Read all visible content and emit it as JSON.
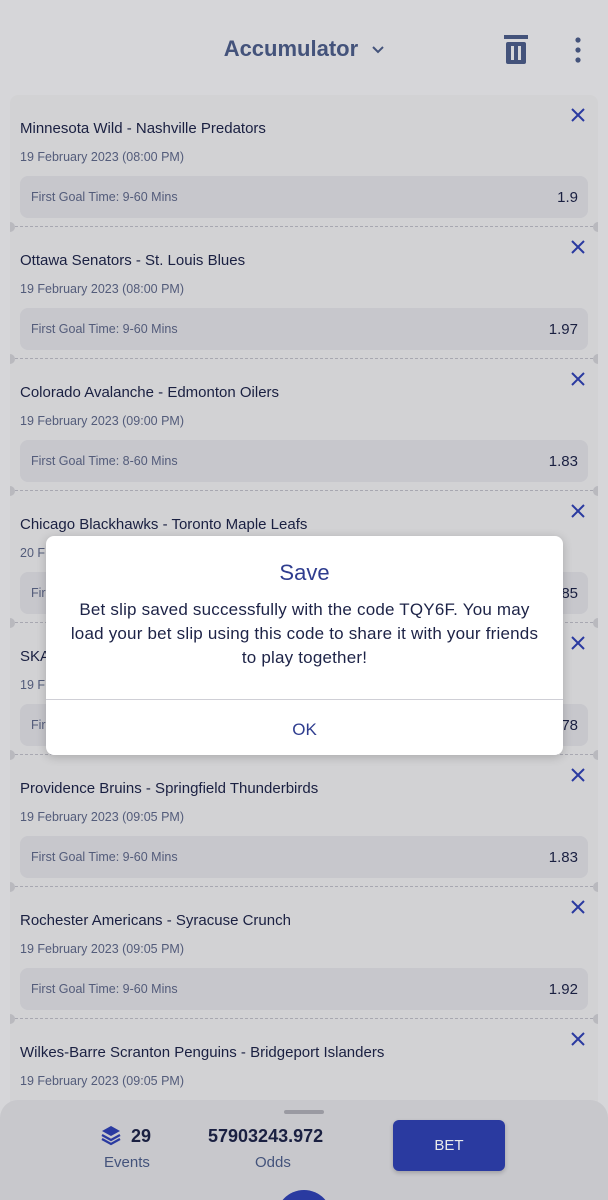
{
  "header": {
    "title": "Accumulator"
  },
  "bets": [
    {
      "match": "Minnesota Wild - Nashville Predators",
      "date": "19 February 2023 (08:00 PM)",
      "market": "First Goal Time: 9-60 Mins",
      "odd": "1.9"
    },
    {
      "match": "Ottawa Senators - St. Louis Blues",
      "date": "19 February 2023 (08:00 PM)",
      "market": "First Goal Time: 9-60 Mins",
      "odd": "1.97"
    },
    {
      "match": "Colorado Avalanche - Edmonton Oilers",
      "date": "19 February 2023 (09:00 PM)",
      "market": "First Goal Time: 8-60 Mins",
      "odd": "1.83"
    },
    {
      "match": "Chicago Blackhawks - Toronto Maple Leafs",
      "date": "20 F",
      "market": "Fir",
      "odd": "85"
    },
    {
      "match": "SKA",
      "date": "19 F",
      "market": "Fir",
      "odd": "78"
    },
    {
      "match": "Providence Bruins - Springfield Thunderbirds",
      "date": "19 February 2023 (09:05 PM)",
      "market": "First Goal Time: 9-60 Mins",
      "odd": "1.83"
    },
    {
      "match": "Rochester Americans - Syracuse Crunch",
      "date": "19 February 2023 (09:05 PM)",
      "market": "First Goal Time: 9-60 Mins",
      "odd": "1.92"
    },
    {
      "match": "Wilkes-Barre Scranton Penguins - Bridgeport Islanders",
      "date": "19 February 2023 (09:05 PM)",
      "market": "",
      "odd": ""
    }
  ],
  "summary": {
    "events_count": "29",
    "events_label": "Events",
    "odds_value": "57903243.972",
    "odds_label": "Odds",
    "bet_label": "BET"
  },
  "dialog": {
    "title": "Save",
    "message": "Bet slip saved successfully with the code TQY6F. You may load your bet slip using this code to share it with your friends to play together!",
    "ok_label": "OK"
  },
  "colors": {
    "accent": "#2e3fae",
    "text": "#1d2347",
    "header": "#4a5b86"
  }
}
